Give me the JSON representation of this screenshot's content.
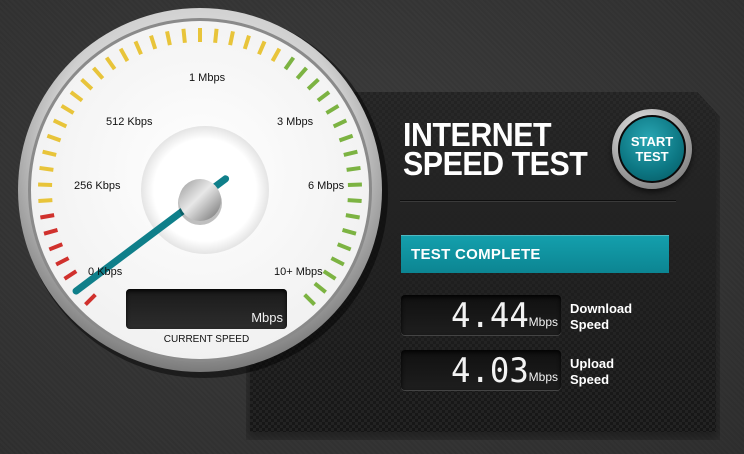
{
  "gauge": {
    "scale_labels": [
      "0 Kbps",
      "256 Kbps",
      "512 Kbps",
      "1 Mbps",
      "3 Mbps",
      "6 Mbps",
      "10+ Mbps"
    ],
    "needle_level": 0.03,
    "current_speed_value": "",
    "current_speed_unit": "Mbps",
    "current_speed_label": "CURRENT SPEED",
    "colors": {
      "red": "#d0312d",
      "yellow": "#e8c43a",
      "green": "#7cb342",
      "needle": "#0f7f8a"
    }
  },
  "panel": {
    "title_line1": "INTERNET",
    "title_line2": "SPEED TEST",
    "start_button": {
      "line1": "START",
      "line2": "TEST"
    },
    "status_text": "TEST COMPLETE",
    "download": {
      "value": "4.44",
      "unit": "Mbps",
      "label_line1": "Download",
      "label_line2": "Speed"
    },
    "upload": {
      "value": "4.03",
      "unit": "Mbps",
      "label_line1": "Upload",
      "label_line2": "Speed"
    },
    "accent_color": "#0f8c99"
  }
}
